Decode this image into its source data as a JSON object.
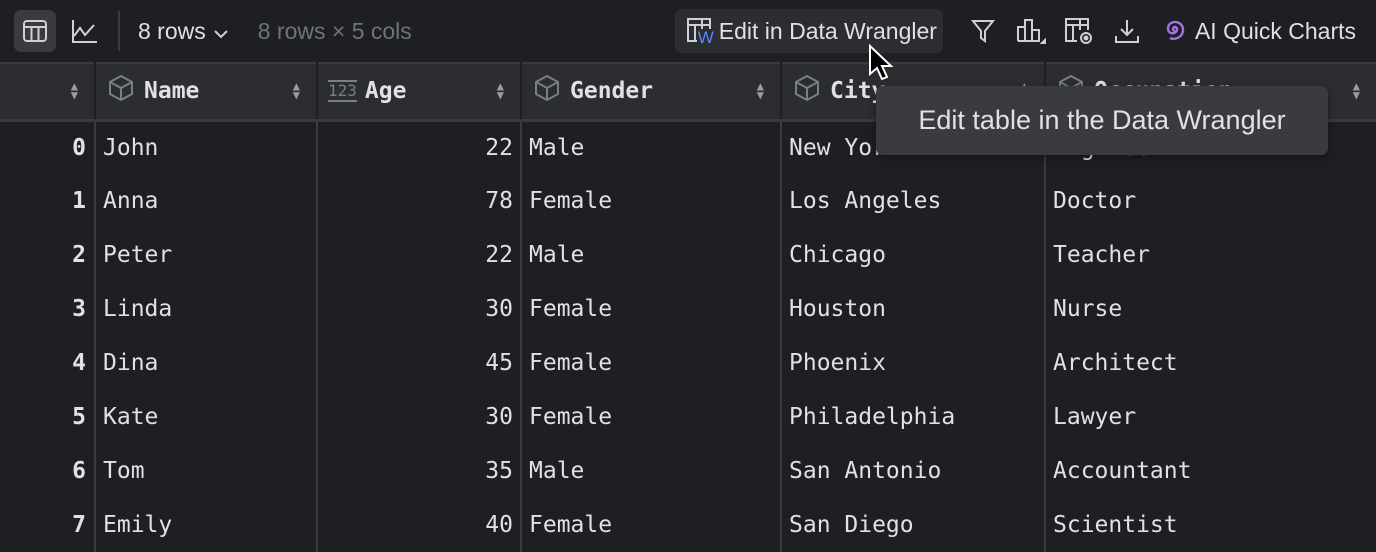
{
  "toolbar": {
    "rows_selector": "8 rows",
    "dimensions": "8 rows × 5 cols",
    "wrangler_button": "Edit in Data Wrangler",
    "ai_charts": "AI Quick Charts",
    "wrangler_badge": "W"
  },
  "tooltip": "Edit table in the Data Wrangler",
  "columns": [
    {
      "label": "Name",
      "type": "object"
    },
    {
      "label": "Age",
      "type": "int",
      "type_badge": "123"
    },
    {
      "label": "Gender",
      "type": "object"
    },
    {
      "label": "City",
      "type": "object"
    },
    {
      "label": "Occupation",
      "type": "object"
    }
  ],
  "rows": [
    {
      "index": "0",
      "name": "John",
      "age": "22",
      "gender": "Male",
      "city": "New York",
      "occupation": "Engineer"
    },
    {
      "index": "1",
      "name": "Anna",
      "age": "78",
      "gender": "Female",
      "city": "Los Angeles",
      "occupation": "Doctor"
    },
    {
      "index": "2",
      "name": "Peter",
      "age": "22",
      "gender": "Male",
      "city": "Chicago",
      "occupation": "Teacher"
    },
    {
      "index": "3",
      "name": "Linda",
      "age": "30",
      "gender": "Female",
      "city": "Houston",
      "occupation": "Nurse"
    },
    {
      "index": "4",
      "name": "Dina",
      "age": "45",
      "gender": "Female",
      "city": "Phoenix",
      "occupation": "Architect"
    },
    {
      "index": "5",
      "name": "Kate",
      "age": "30",
      "gender": "Female",
      "city": "Philadelphia",
      "occupation": "Lawyer"
    },
    {
      "index": "6",
      "name": "Tom",
      "age": "35",
      "gender": "Male",
      "city": "San Antonio",
      "occupation": "Accountant"
    },
    {
      "index": "7",
      "name": "Emily",
      "age": "40",
      "gender": "Female",
      "city": "San Diego",
      "occupation": "Scientist"
    }
  ],
  "colors": {
    "background": "#1e1f22",
    "header": "#2b2d30",
    "accent": "#a571e6",
    "wrangler_w": "#548af7"
  }
}
